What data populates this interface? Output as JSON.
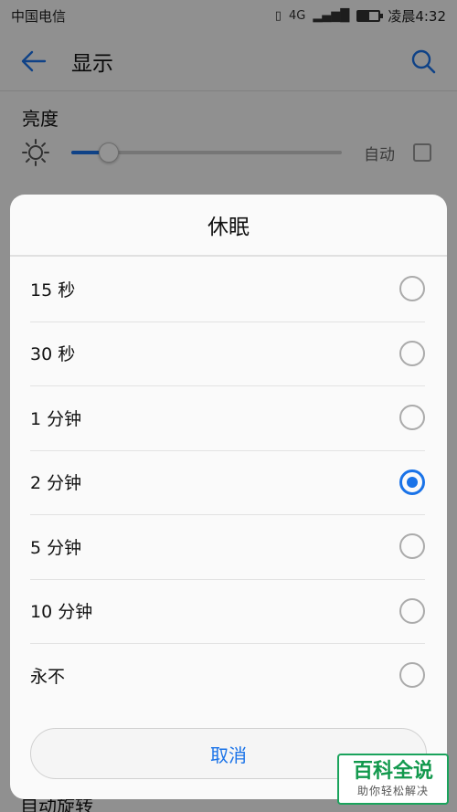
{
  "status_bar": {
    "carrier": "中国电信",
    "network": "4G",
    "time": "凌晨4:32"
  },
  "header": {
    "title": "显示"
  },
  "brightness": {
    "label": "亮度",
    "auto_label": "自动",
    "level_fraction": 0.14
  },
  "background_bottom_row": "自动旋转",
  "dialog": {
    "title": "休眠",
    "options": [
      {
        "label": "15 秒",
        "selected": false
      },
      {
        "label": "30 秒",
        "selected": false
      },
      {
        "label": "1 分钟",
        "selected": false
      },
      {
        "label": "2 分钟",
        "selected": true
      },
      {
        "label": "5 分钟",
        "selected": false
      },
      {
        "label": "10 分钟",
        "selected": false
      },
      {
        "label": "永不",
        "selected": false
      }
    ],
    "cancel_label": "取消"
  },
  "watermark": {
    "title": "百科全说",
    "subtitle": "助你轻松解决"
  },
  "colors": {
    "accent": "#1a73e8",
    "watermark_green": "#12994d"
  }
}
